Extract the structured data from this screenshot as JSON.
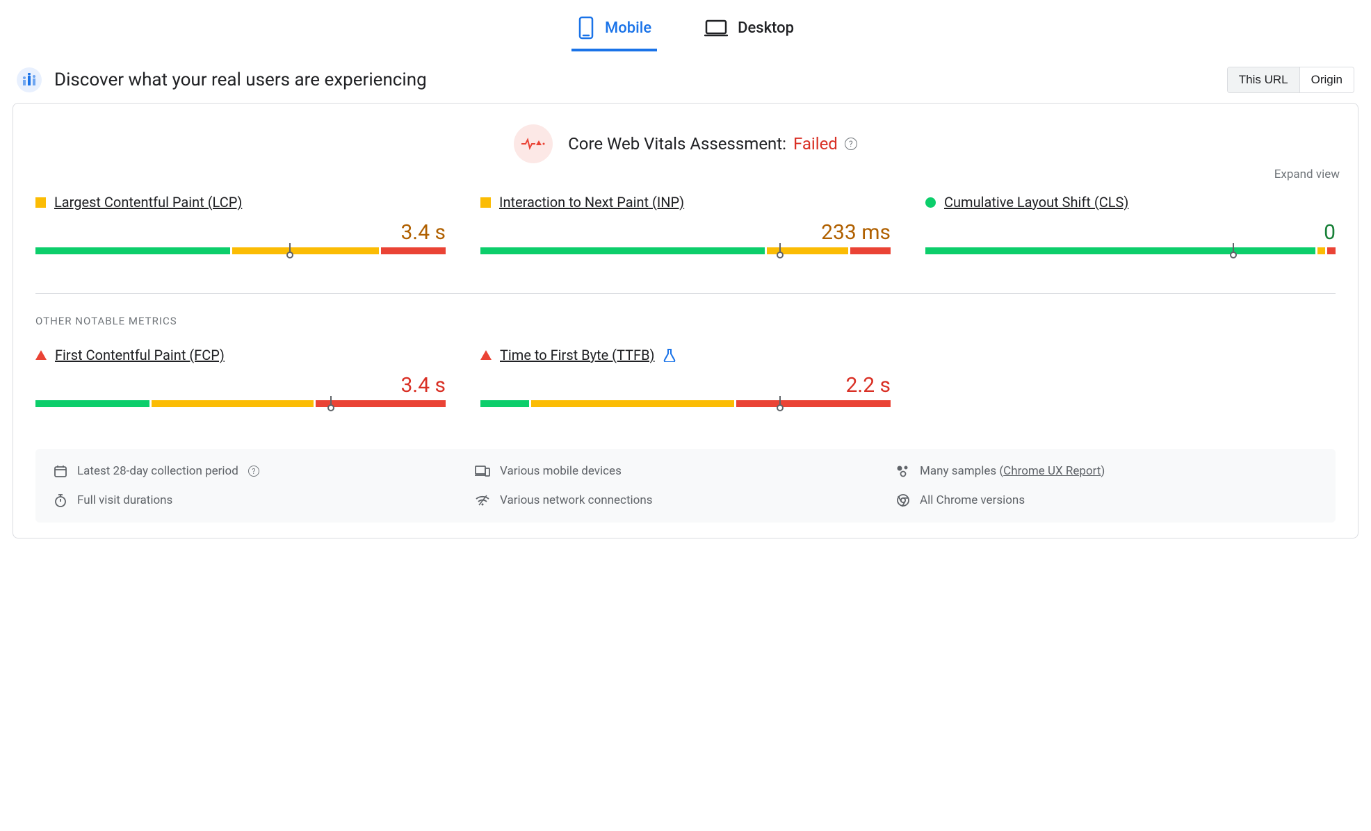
{
  "tabs": {
    "mobile": "Mobile",
    "desktop": "Desktop",
    "active": "mobile"
  },
  "header": {
    "title": "Discover what your real users are experiencing"
  },
  "scope": {
    "this_url": "This URL",
    "origin": "Origin",
    "active": "this_url"
  },
  "assessment": {
    "label": "Core Web Vitals Assessment:",
    "status": "Failed",
    "status_color": "red"
  },
  "expand": "Expand view",
  "core_metrics": [
    {
      "key": "lcp",
      "name": "Largest Contentful Paint (LCP)",
      "value": "3.4 s",
      "rating": "amber",
      "shape": "square",
      "bar": {
        "good": 48,
        "needs": 36,
        "poor": 16,
        "marker": 62
      }
    },
    {
      "key": "inp",
      "name": "Interaction to Next Paint (INP)",
      "value": "233 ms",
      "rating": "amber",
      "shape": "square",
      "bar": {
        "good": 70,
        "needs": 20,
        "poor": 10,
        "marker": 73
      }
    },
    {
      "key": "cls",
      "name": "Cumulative Layout Shift (CLS)",
      "value": "0",
      "rating": "green",
      "shape": "circle",
      "bar": {
        "good": 96,
        "needs": 2,
        "poor": 2,
        "marker": 75
      }
    }
  ],
  "other_label": "OTHER NOTABLE METRICS",
  "other_metrics": [
    {
      "key": "fcp",
      "name": "First Contentful Paint (FCP)",
      "value": "3.4 s",
      "rating": "red",
      "shape": "triangle",
      "bar": {
        "good": 28,
        "needs": 40,
        "poor": 32,
        "marker": 72
      }
    },
    {
      "key": "ttfb",
      "name": "Time to First Byte (TTFB)",
      "value": "2.2 s",
      "rating": "red",
      "shape": "triangle",
      "experimental": true,
      "bar": {
        "good": 12,
        "needs": 50,
        "poor": 38,
        "marker": 73
      }
    }
  ],
  "info": {
    "period": "Latest 28-day collection period",
    "devices": "Various mobile devices",
    "samples_prefix": "Many samples (",
    "samples_link": "Chrome UX Report",
    "samples_suffix": ")",
    "durations": "Full visit durations",
    "network": "Various network connections",
    "versions": "All Chrome versions"
  }
}
